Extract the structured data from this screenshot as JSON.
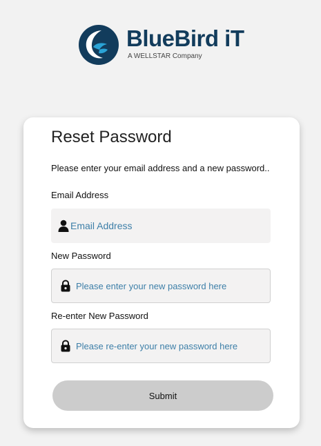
{
  "brand": {
    "name": "BlueBird iT",
    "tagline": "A WELLSTAR Company",
    "primary_color": "#123c5c",
    "accent_color": "#2aa3d6"
  },
  "form": {
    "title": "Reset Password",
    "instructions": "Please enter your email address and a new password..",
    "email": {
      "label": "Email Address",
      "icon": "user-icon",
      "placeholder": "Email Address",
      "value": ""
    },
    "new_password": {
      "label": "New Password",
      "icon": "lock-icon",
      "placeholder": "Please enter your new password here",
      "value": ""
    },
    "confirm_password": {
      "label": "Re-enter New Password",
      "icon": "lock-icon",
      "placeholder": "Please re-enter your new password here",
      "value": ""
    },
    "submit_label": "Submit"
  }
}
